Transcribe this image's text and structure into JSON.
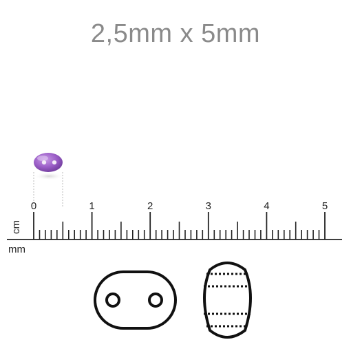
{
  "title": "2,5mm x 5mm",
  "ruler": {
    "unit_cm": "cm",
    "unit_mm": "mm",
    "labels": [
      "0",
      "1",
      "2",
      "3",
      "4",
      "5"
    ],
    "max_cm": 5
  },
  "bead": {
    "color": "#9c5fc8",
    "width_mm": 5,
    "height_mm": 2.5
  },
  "colors": {
    "title": "#8a8a8a",
    "ruler": "#222222",
    "outline": "#111111"
  }
}
